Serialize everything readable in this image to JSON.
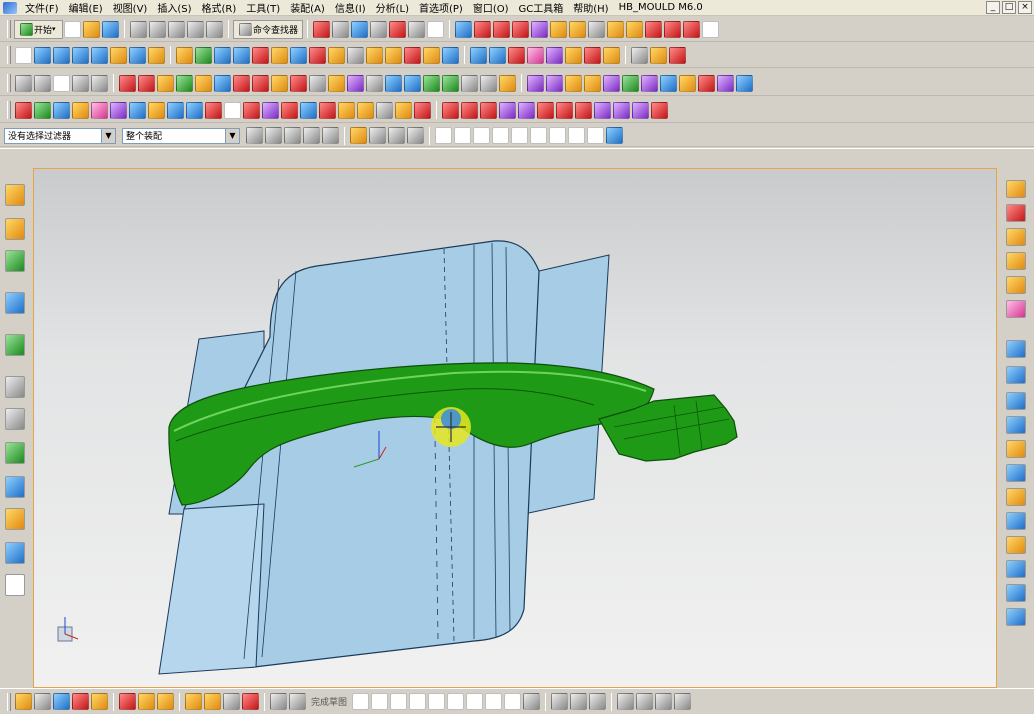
{
  "menubar": {
    "items": [
      "文件(F)",
      "编辑(E)",
      "视图(V)",
      "插入(S)",
      "格式(R)",
      "工具(T)",
      "装配(A)",
      "信息(I)",
      "分析(L)",
      "首选项(P)",
      "窗口(O)",
      "GC工具箱",
      "帮助(H)",
      "HB_MOULD M6.0"
    ],
    "window_controls": [
      "_",
      "□",
      "×"
    ]
  },
  "toolbar1": {
    "start_label": "开始",
    "command_finder_label": "命令查找器"
  },
  "selection_bar": {
    "filter_value": "没有选择过滤器",
    "scope_value": "整个装配"
  },
  "viewport": {
    "model_parts": [
      "cavity-surface",
      "handle-body",
      "handle-bracket"
    ],
    "colors": {
      "surface": "#a7cde6",
      "handle": "#1f9a16",
      "edge": "#1b3a5a",
      "cursor": "#e6e61e"
    }
  },
  "bottombar": {
    "sketch_label": "完成草图"
  },
  "icons": {
    "left": [
      "assembly-navigator-icon",
      "part-navigator-icon",
      "reuse-library-icon",
      "web-browser-icon",
      "history-icon",
      "process-studio-icon",
      "roles-icon",
      "system-materials-icon",
      "palettes-icon",
      "document-icon",
      "list-icon"
    ],
    "right": [
      "mold-wizard-icon",
      "mold-tool-icon",
      "block-icon",
      "cavity-icon",
      "core-icon",
      "parting-icon",
      "ejector-icon",
      "pin-icon",
      "slide-icon",
      "lifter-icon",
      "gate-icon",
      "runner-icon",
      "cooling-icon",
      "electrode-icon",
      "bom-icon",
      "drawing-icon"
    ]
  }
}
